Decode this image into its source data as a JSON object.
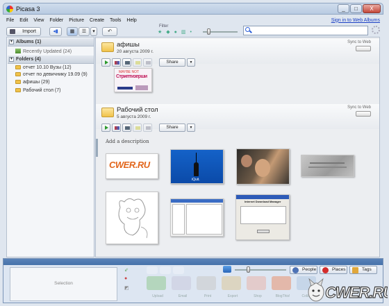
{
  "window": {
    "title": "Picasa 3",
    "min": "_",
    "max": "□",
    "close": "X"
  },
  "menu": {
    "items": [
      "File",
      "Edit",
      "View",
      "Folder",
      "Picture",
      "Create",
      "Tools",
      "Help"
    ],
    "signin": "Sign in to Web Albums"
  },
  "toolbar": {
    "import": "Import",
    "filters_label": "Filter",
    "search_placeholder": "",
    "thumb_slider_percent": 15
  },
  "sidebar": {
    "albums_header": "Albums (1)",
    "recently_updated": "Recently Updated (24)",
    "folders_header": "Folders (4)",
    "folders": [
      "отчет 10.10 Вузы (12)",
      "отчет по девичнику 19.09 (9)",
      "афишы (29)",
      "Рабочий стол (7)"
    ]
  },
  "groups": [
    {
      "name": "афишы",
      "date": "20 августа 2009 г.",
      "sync": "Sync to Web",
      "share": "Share"
    },
    {
      "name": "Рабочий стол",
      "date": "5 августа 2009 г.",
      "sync": "Sync to Web",
      "share": "Share"
    }
  ],
  "main": {
    "add_description": "Add a description",
    "poster_caption": "Стриптизерши",
    "poster_top": "MAYBE NOT",
    "thumb_logo": "CWER.RU",
    "thumb_blue_caption": "iQuit.",
    "dialog_title": "Internet Download Manager"
  },
  "bottom": {
    "selection": "Selection",
    "zoom_percent": 25,
    "people": "People",
    "places": "Places",
    "tags": "Tags",
    "actions": [
      "Upload",
      "Email",
      "Print",
      "Export",
      "Shop",
      "BlogThis!",
      "Collage",
      "Movie"
    ]
  },
  "watermark": "CWER.RU",
  "colors": {
    "link": "#1a3fc4",
    "bottom_band": "#4672aa",
    "folder": "#f0c24a",
    "play": "#2d9a2d"
  }
}
